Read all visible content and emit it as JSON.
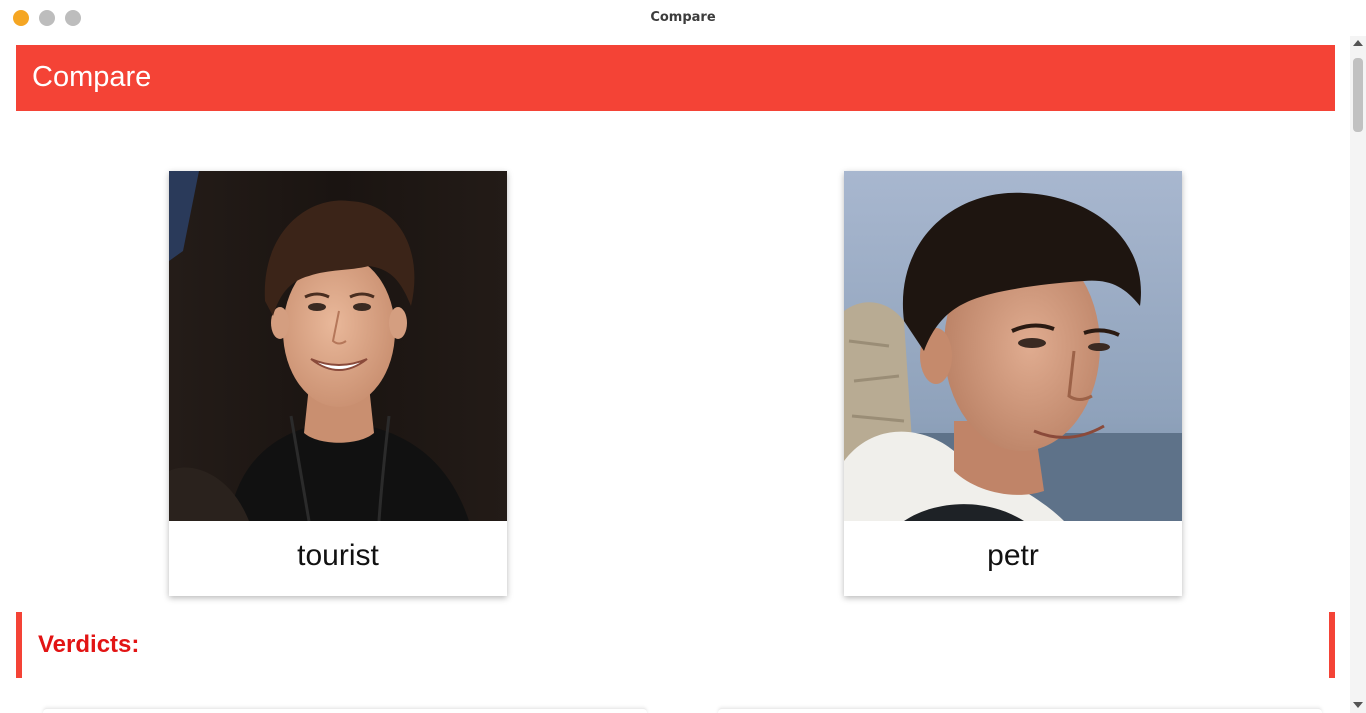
{
  "window": {
    "title": "Compare",
    "accent_color": "#f44336",
    "verdict_text_color": "#e21414"
  },
  "header": {
    "title": "Compare"
  },
  "compare": {
    "users": [
      {
        "name": "tourist",
        "photo_icon": "profile-photo"
      },
      {
        "name": "petr",
        "photo_icon": "profile-photo"
      }
    ]
  },
  "verdicts": {
    "title": "Verdicts:"
  }
}
